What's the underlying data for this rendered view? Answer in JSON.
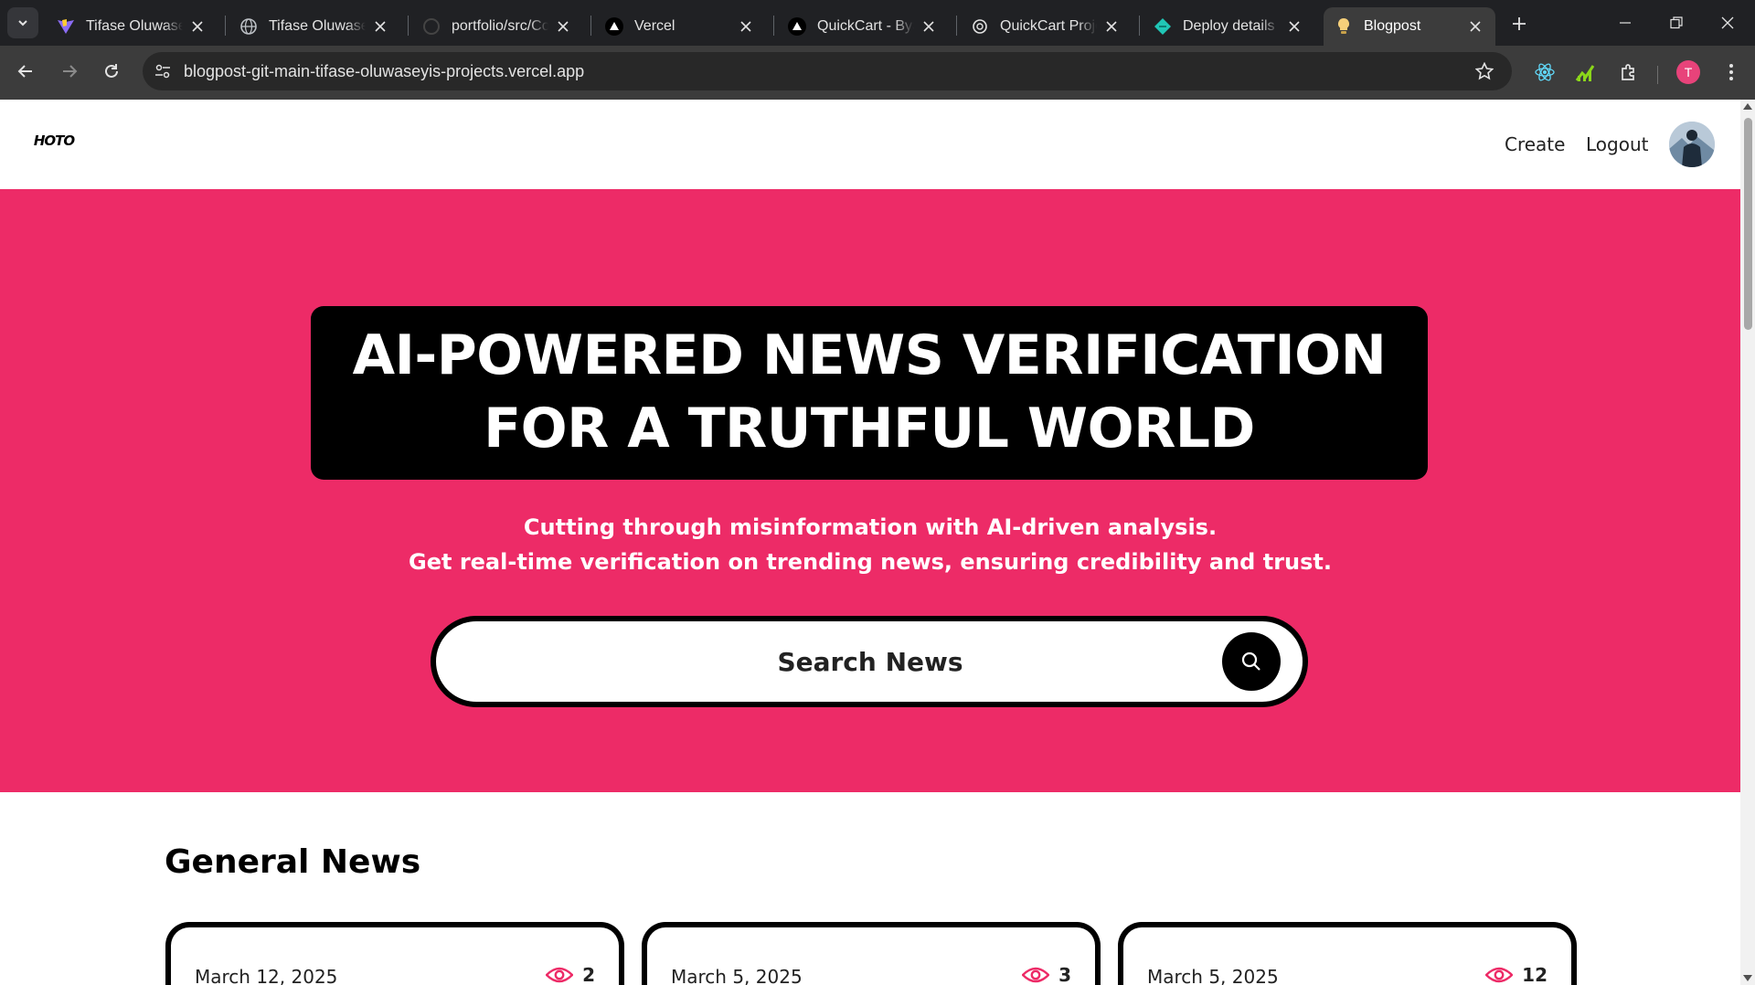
{
  "browser": {
    "tabs": [
      {
        "title": "Tifase Oluwaseyi",
        "icon": "vite-icon",
        "active": false
      },
      {
        "title": "Tifase Oluwaseyi",
        "icon": "globe-icon",
        "active": false
      },
      {
        "title": "portfolio/src/Com",
        "icon": "github-icon",
        "active": false
      },
      {
        "title": "Vercel",
        "icon": "vercel-icon",
        "active": false
      },
      {
        "title": "QuickCart - BySm",
        "icon": "vercel-icon",
        "active": false
      },
      {
        "title": "QuickCart Projec",
        "icon": "openai-icon",
        "active": false
      },
      {
        "title": "Deploy details | N",
        "icon": "netlify-icon",
        "active": false
      },
      {
        "title": "Blogpost",
        "icon": "lightbulb-icon",
        "active": true
      }
    ],
    "url": "blogpost-git-main-tifase-oluwaseyis-projects.vercel.app",
    "profile_initial": "T",
    "accent": "#e8437a"
  },
  "site": {
    "logo_text": "HOTO",
    "nav": {
      "create": "Create",
      "logout": "Logout"
    },
    "hero": {
      "headline_line1": "AI-POWERED NEWS VERIFICATION",
      "headline_line2": "FOR A TRUTHFUL WORLD",
      "sub_line1": "Cutting through misinformation with AI-driven analysis.",
      "sub_line2": "Get real-time verification on trending news, ensuring credibility and trust.",
      "search_placeholder": "Search News",
      "background": "#ed2b67"
    },
    "section_title": "General News",
    "cards": [
      {
        "date": "March 12, 2025",
        "views": "2"
      },
      {
        "date": "March 5, 2025",
        "views": "3"
      },
      {
        "date": "March 5, 2025",
        "views": "12"
      }
    ]
  }
}
